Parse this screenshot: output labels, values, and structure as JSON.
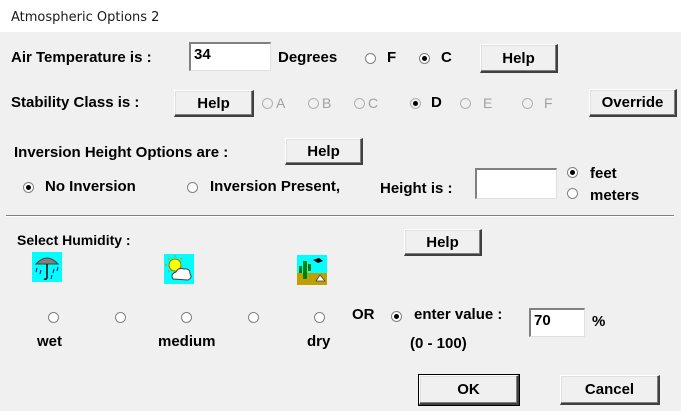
{
  "window": {
    "title": "Atmospheric Options 2"
  },
  "air_temperature": {
    "label": "Air Temperature is :",
    "value": "34",
    "units_label": "Degrees",
    "unit_f": "F",
    "unit_c": "C",
    "selected_unit": "C",
    "help": "Help"
  },
  "stability": {
    "label": "Stability Class is :",
    "help": "Help",
    "classes": [
      "A",
      "B",
      "C",
      "D",
      "E",
      "F"
    ],
    "selected": "D",
    "override": "Override"
  },
  "inversion": {
    "label": "Inversion Height Options are :",
    "help": "Help",
    "no_inversion": "No Inversion",
    "inversion_present": "Inversion Present,",
    "height_label": "Height is :",
    "height_value": "",
    "feet": "feet",
    "meters": "meters",
    "selected_option": "No Inversion",
    "selected_unit": "feet"
  },
  "humidity": {
    "label": "Select Humidity :",
    "help": "Help",
    "wet": "wet",
    "medium": "medium",
    "dry": "dry",
    "or": "OR",
    "enter_value": "enter value :",
    "value": "70",
    "percent": "%",
    "range": "(0 - 100)",
    "icons": [
      "umbrella-rain-icon",
      "sun-cloud-icon",
      "desert-cactus-icon"
    ]
  },
  "actions": {
    "ok": "OK",
    "cancel": "Cancel"
  }
}
